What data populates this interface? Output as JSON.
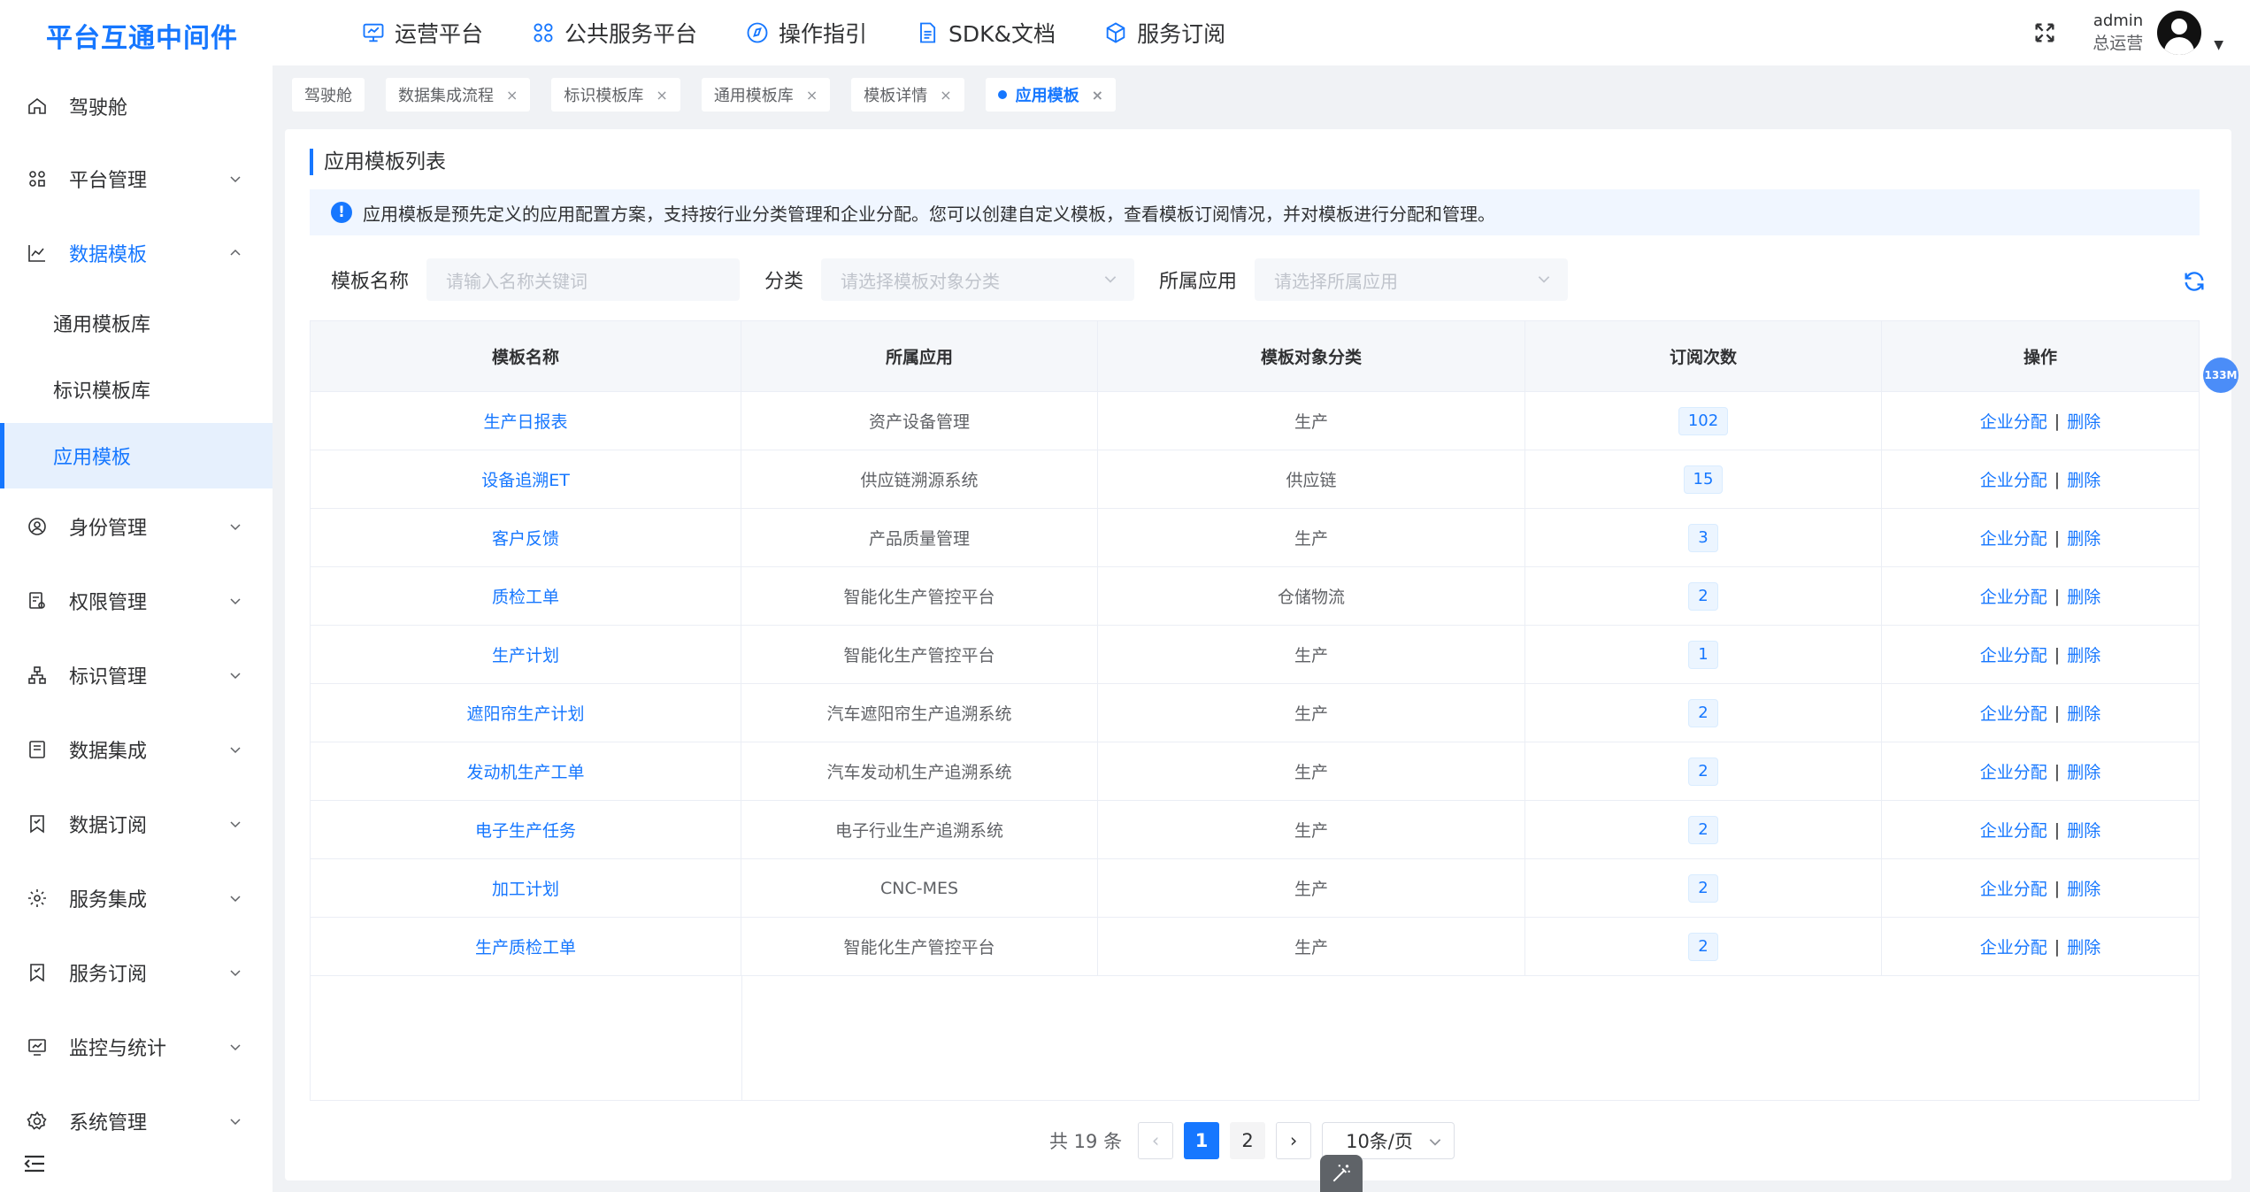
{
  "app": {
    "logo": "平台互通中间件"
  },
  "topnav": [
    {
      "label": "运营平台",
      "icon": "monitor-icon"
    },
    {
      "label": "公共服务平台",
      "icon": "grid-icon"
    },
    {
      "label": "操作指引",
      "icon": "compass-icon"
    },
    {
      "label": "SDK&文档",
      "icon": "document-icon"
    },
    {
      "label": "服务订阅",
      "icon": "cube-icon"
    }
  ],
  "user": {
    "name": "admin",
    "role": "总运营"
  },
  "sidebar": {
    "items": [
      {
        "label": "驾驶舱",
        "icon": "home-icon"
      },
      {
        "label": "平台管理",
        "icon": "apps-icon"
      },
      {
        "label": "数据模板",
        "icon": "chart-line-icon"
      },
      {
        "label": "身份管理",
        "icon": "user-circle-icon"
      },
      {
        "label": "权限管理",
        "icon": "permission-icon"
      },
      {
        "label": "标识管理",
        "icon": "hierarchy-icon"
      },
      {
        "label": "数据集成",
        "icon": "data-integration-icon"
      },
      {
        "label": "数据订阅",
        "icon": "bookmark-icon"
      },
      {
        "label": "服务集成",
        "icon": "gear-icon"
      },
      {
        "label": "服务订阅",
        "icon": "bookmark-icon"
      },
      {
        "label": "监控与统计",
        "icon": "monitor-stats-icon"
      },
      {
        "label": "系统管理",
        "icon": "settings-icon"
      }
    ],
    "subitems": [
      "通用模板库",
      "标识模板库",
      "应用模板"
    ]
  },
  "tabs": [
    {
      "label": "驾驶舱",
      "closable": false
    },
    {
      "label": "数据集成流程",
      "closable": true
    },
    {
      "label": "标识模板库",
      "closable": true
    },
    {
      "label": "通用模板库",
      "closable": true
    },
    {
      "label": "模板详情",
      "closable": true
    },
    {
      "label": "应用模板",
      "closable": true,
      "active": true
    }
  ],
  "page": {
    "title": "应用模板列表",
    "notice": "应用模板是预先定义的应用配置方案，支持按行业分类管理和企业分配。您可以创建自定义模板，查看模板订阅情况，并对模板进行分配和管理。",
    "notice_icon": "!",
    "close_symbol": "×"
  },
  "filters": {
    "name_label": "模板名称",
    "name_placeholder": "请输入名称关键词",
    "category_label": "分类",
    "category_placeholder": "请选择模板对象分类",
    "app_label": "所属应用",
    "app_placeholder": "请选择所属应用"
  },
  "table": {
    "headers": [
      "模板名称",
      "所属应用",
      "模板对象分类",
      "订阅次数",
      "操作"
    ],
    "op_assign": "企业分配",
    "op_separator": "|",
    "op_delete": "删除",
    "rows": [
      {
        "name": "生产日报表",
        "app": "资产设备管理",
        "category": "生产",
        "count": "102"
      },
      {
        "name": "设备追溯ET",
        "app": "供应链溯源系统",
        "category": "供应链",
        "count": "15"
      },
      {
        "name": "客户反馈",
        "app": "产品质量管理",
        "category": "生产",
        "count": "3"
      },
      {
        "name": "质检工单",
        "app": "智能化生产管控平台",
        "category": "仓储物流",
        "count": "2"
      },
      {
        "name": "生产计划",
        "app": "智能化生产管控平台",
        "category": "生产",
        "count": "1"
      },
      {
        "name": "遮阳帘生产计划",
        "app": "汽车遮阳帘生产追溯系统",
        "category": "生产",
        "count": "2"
      },
      {
        "name": "发动机生产工单",
        "app": "汽车发动机生产追溯系统",
        "category": "生产",
        "count": "2"
      },
      {
        "name": "电子生产任务",
        "app": "电子行业生产追溯系统",
        "category": "生产",
        "count": "2"
      },
      {
        "name": "加工计划",
        "app": "CNC-MES",
        "category": "生产",
        "count": "2"
      },
      {
        "name": "生产质检工单",
        "app": "智能化生产管控平台",
        "category": "生产",
        "count": "2"
      }
    ]
  },
  "pagination": {
    "total": "共 19 条",
    "prev": "‹",
    "next": "›",
    "pages": [
      "1",
      "2"
    ],
    "current": "1",
    "page_size": "10条/页"
  },
  "float_badge": "133M",
  "colors": {
    "primary": "#1677ff",
    "notice_bg": "#f0f6ff",
    "active_bg": "#e6f0fd"
  }
}
